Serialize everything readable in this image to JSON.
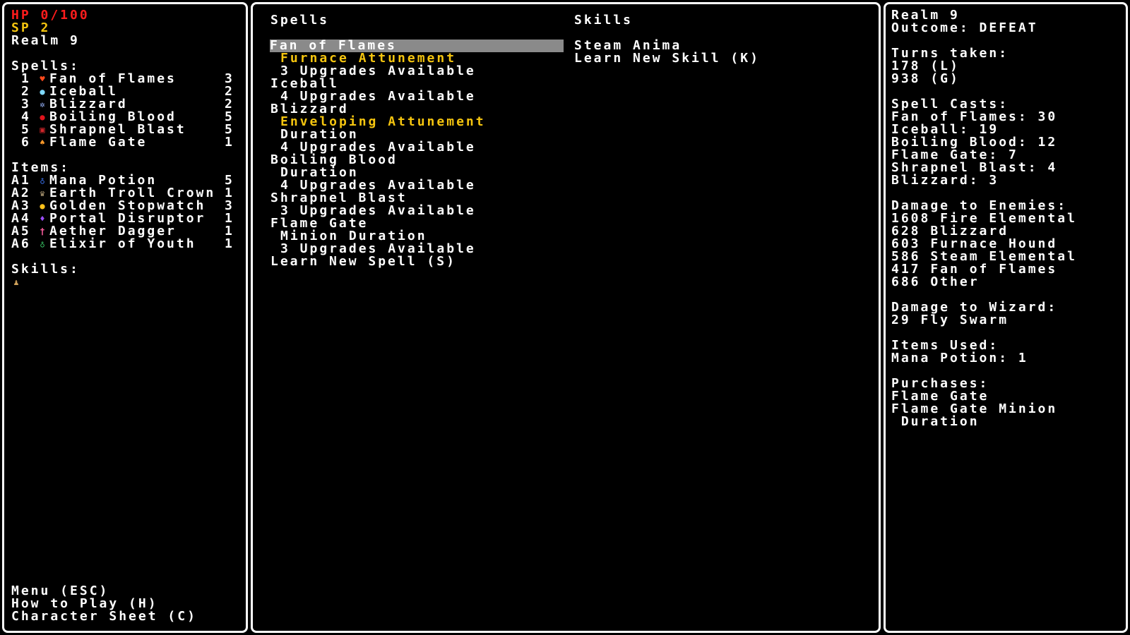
{
  "status": {
    "hp": "HP 0/100",
    "sp": "SP 2",
    "realm": "Realm 9"
  },
  "left": {
    "spells_header": "Spells:",
    "spells": [
      {
        "slot": "1",
        "name": "Fan of Flames",
        "count": "3",
        "icon": "fire-fan-icon",
        "color": "#ff4a1c"
      },
      {
        "slot": "2",
        "name": "Iceball",
        "count": "2",
        "icon": "iceball-icon",
        "color": "#7fd9ff"
      },
      {
        "slot": "3",
        "name": "Blizzard",
        "count": "2",
        "icon": "blizzard-icon",
        "color": "#9ab6ff"
      },
      {
        "slot": "4",
        "name": "Boiling Blood",
        "count": "5",
        "icon": "blood-drop-icon",
        "color": "#e0141c"
      },
      {
        "slot": "5",
        "name": "Shrapnel Blast",
        "count": "5",
        "icon": "shrapnel-icon",
        "color": "#d2262a"
      },
      {
        "slot": "6",
        "name": "Flame Gate",
        "count": "1",
        "icon": "flame-gate-icon",
        "color": "#ff9a2a"
      }
    ],
    "items_header": "Items:",
    "items": [
      {
        "slot": "A1",
        "name": "Mana Potion",
        "count": "5",
        "icon": "mana-potion-icon",
        "color": "#3f7bff"
      },
      {
        "slot": "A2",
        "name": "Earth Troll Crown",
        "count": "1",
        "icon": "crown-icon",
        "color": "#b7a27a"
      },
      {
        "slot": "A3",
        "name": "Golden Stopwatch",
        "count": "3",
        "icon": "stopwatch-icon",
        "color": "#ffc21a"
      },
      {
        "slot": "A4",
        "name": "Portal Disruptor",
        "count": "1",
        "icon": "portal-disruptor-icon",
        "color": "#9b4dff"
      },
      {
        "slot": "A5",
        "name": "Aether Dagger",
        "count": "1",
        "icon": "dagger-icon",
        "color": "#ff5fa0"
      },
      {
        "slot": "A6",
        "name": "Elixir of Youth",
        "count": "1",
        "icon": "elixir-icon",
        "color": "#3bd16b"
      }
    ],
    "skills_header": "Skills:",
    "skill_icon": {
      "icon": "steam-anima-icon",
      "color": "#cfa15a"
    },
    "menu": [
      "Menu (ESC)",
      "How to Play (H)",
      "Character Sheet (C)"
    ]
  },
  "middle": {
    "spells_header": "Spells",
    "skills_header": "Skills",
    "spell_lines": [
      {
        "text": "Fan of Flames",
        "indent": 0,
        "style": "sel"
      },
      {
        "text": "Furnace Attunement",
        "indent": 1,
        "style": "yellow"
      },
      {
        "text": "3 Upgrades Available",
        "indent": 1,
        "style": "white"
      },
      {
        "text": "Iceball",
        "indent": 0,
        "style": "white"
      },
      {
        "text": "4 Upgrades Available",
        "indent": 1,
        "style": "white"
      },
      {
        "text": "Blizzard",
        "indent": 0,
        "style": "white"
      },
      {
        "text": "Enveloping Attunement",
        "indent": 1,
        "style": "yellow"
      },
      {
        "text": "Duration",
        "indent": 1,
        "style": "white"
      },
      {
        "text": "4 Upgrades Available",
        "indent": 1,
        "style": "white"
      },
      {
        "text": "Boiling Blood",
        "indent": 0,
        "style": "white"
      },
      {
        "text": "Duration",
        "indent": 1,
        "style": "white"
      },
      {
        "text": "4 Upgrades Available",
        "indent": 1,
        "style": "white"
      },
      {
        "text": "Shrapnel Blast",
        "indent": 0,
        "style": "white"
      },
      {
        "text": "3 Upgrades Available",
        "indent": 1,
        "style": "white"
      },
      {
        "text": "Flame Gate",
        "indent": 0,
        "style": "white"
      },
      {
        "text": "Minion Duration",
        "indent": 1,
        "style": "white"
      },
      {
        "text": "3 Upgrades Available",
        "indent": 1,
        "style": "white"
      },
      {
        "text": "Learn New Spell (S)",
        "indent": 0,
        "style": "white"
      }
    ],
    "skill_lines": [
      "Steam Anima",
      "Learn New Skill (K)"
    ]
  },
  "right": {
    "lines": [
      "Realm 9",
      "Outcome: DEFEAT",
      "",
      "Turns taken:",
      "178 (L)",
      "938 (G)",
      "",
      "Spell Casts:",
      "Fan of Flames: 30",
      "Iceball: 19",
      "Boiling Blood: 12",
      "Flame Gate: 7",
      "Shrapnel Blast: 4",
      "Blizzard: 3",
      "",
      "Damage to Enemies:",
      "1608 Fire Elemental",
      "628 Blizzard",
      "603 Furnace Hound",
      "586 Steam Elemental",
      "417 Fan of Flames",
      "686 Other",
      "",
      "Damage to Wizard:",
      "29 Fly Swarm",
      "",
      "Items Used:",
      "Mana Potion: 1",
      "",
      "Purchases:",
      "Flame Gate",
      "Flame Gate Minion",
      " Duration"
    ]
  }
}
